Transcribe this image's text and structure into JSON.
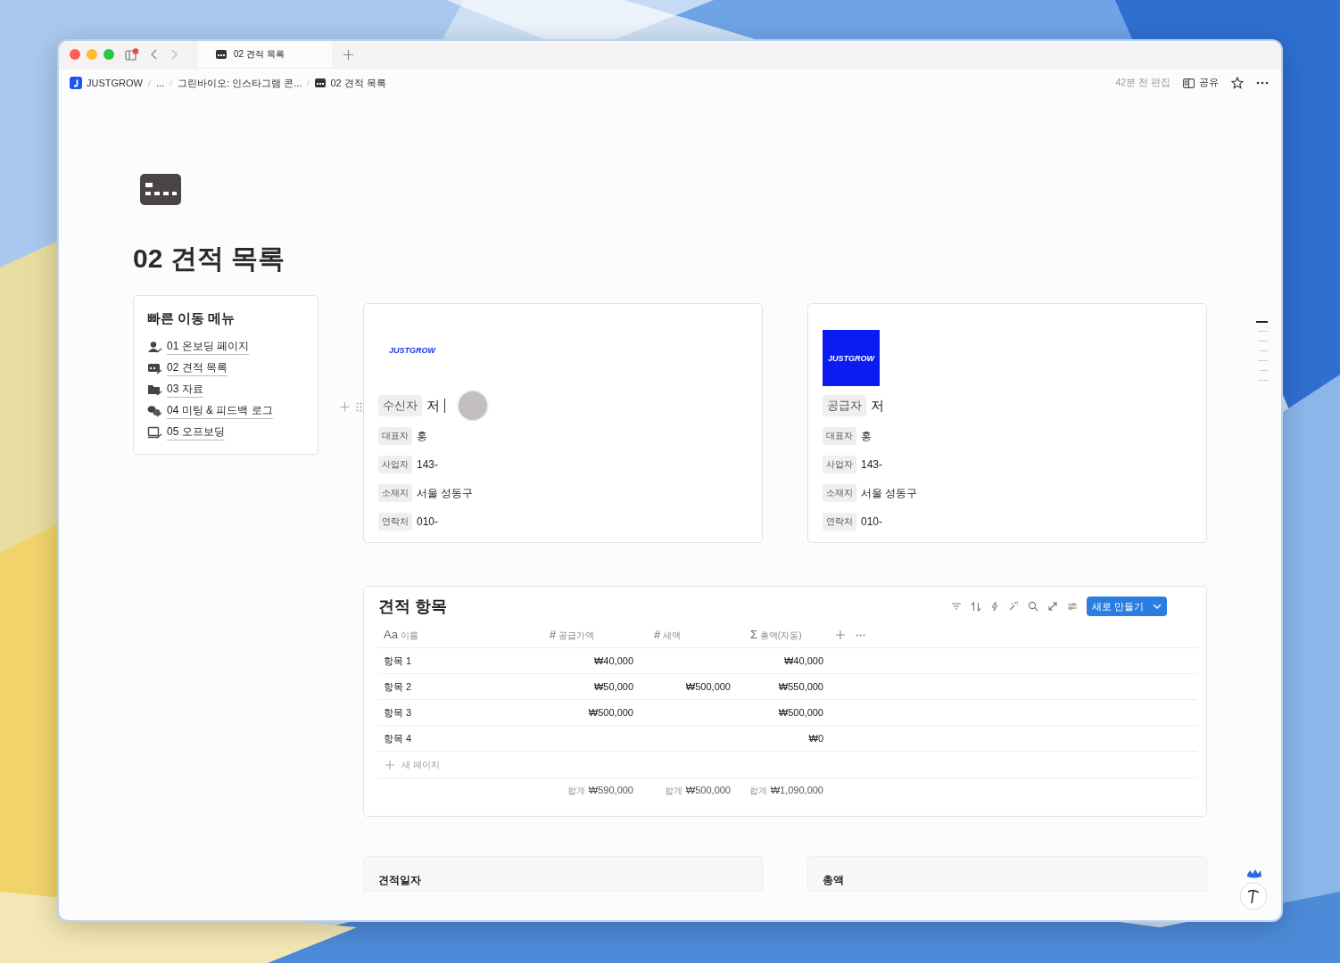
{
  "window": {
    "tab": {
      "title": "02 견적 목록"
    },
    "notification_badge": true
  },
  "breadcrumb": [
    "JUSTGROW",
    "...",
    "그린바이오: 인스타그램 콘...",
    "02 견적 목록"
  ],
  "topbar": {
    "edited": "42분 전 편집",
    "share": "공유"
  },
  "page": {
    "title": "02 견적 목록"
  },
  "quick_menu": {
    "title": "빠른 이동 메뉴",
    "items": [
      {
        "label": "01 온보딩 페이지"
      },
      {
        "label": "02 견적 목록"
      },
      {
        "label": "03 자료"
      },
      {
        "label": "04 미팅 & 피드백 로그"
      },
      {
        "label": "05 오프보딩"
      }
    ]
  },
  "parties": [
    {
      "logo": {
        "text": "JUSTGROW",
        "boxed": false
      },
      "fields": [
        {
          "label": "수신자",
          "value": "저",
          "kind": "heading"
        },
        {
          "label": "대표자",
          "value": "홍",
          "kind": "field"
        },
        {
          "label": "사업자",
          "value": "143-",
          "kind": "field"
        },
        {
          "label": "소재지",
          "value": "서울 성동구",
          "kind": "field"
        },
        {
          "label": "연락처",
          "value": "010-",
          "kind": "field"
        }
      ]
    },
    {
      "logo": {
        "text": "JUSTGROW",
        "boxed": true
      },
      "fields": [
        {
          "label": "공급자",
          "value": "저",
          "kind": "heading"
        },
        {
          "label": "대표자",
          "value": "홍",
          "kind": "field"
        },
        {
          "label": "사업자",
          "value": "143-",
          "kind": "field"
        },
        {
          "label": "소재지",
          "value": "서울 성동구",
          "kind": "field"
        },
        {
          "label": "연락처",
          "value": "010-",
          "kind": "field"
        }
      ]
    }
  ],
  "table": {
    "title": "견적 항목",
    "new_button": "새로 만들기",
    "columns": [
      {
        "icon": "Aa",
        "label": "이름"
      },
      {
        "icon": "#",
        "label": "공급가액"
      },
      {
        "icon": "#",
        "label": "세액"
      },
      {
        "icon": "Σ",
        "label": "총액(자동)"
      }
    ],
    "rows": [
      [
        "항목 1",
        "₩40,000",
        "",
        "₩40,000"
      ],
      [
        "항목 2",
        "₩50,000",
        "₩500,000",
        "₩550,000"
      ],
      [
        "항목 3",
        "₩500,000",
        "",
        "₩500,000"
      ],
      [
        "항목 4",
        "",
        "",
        "₩0"
      ]
    ],
    "new_page": "새 페이지",
    "totals": [
      {
        "label": "합계",
        "value": "₩590,000"
      },
      {
        "label": "합계",
        "value": "₩500,000"
      },
      {
        "label": "합계",
        "value": "₩1,090,000"
      }
    ]
  },
  "bottom_cards": [
    {
      "title": "견적일자"
    },
    {
      "title": "총액"
    }
  ]
}
